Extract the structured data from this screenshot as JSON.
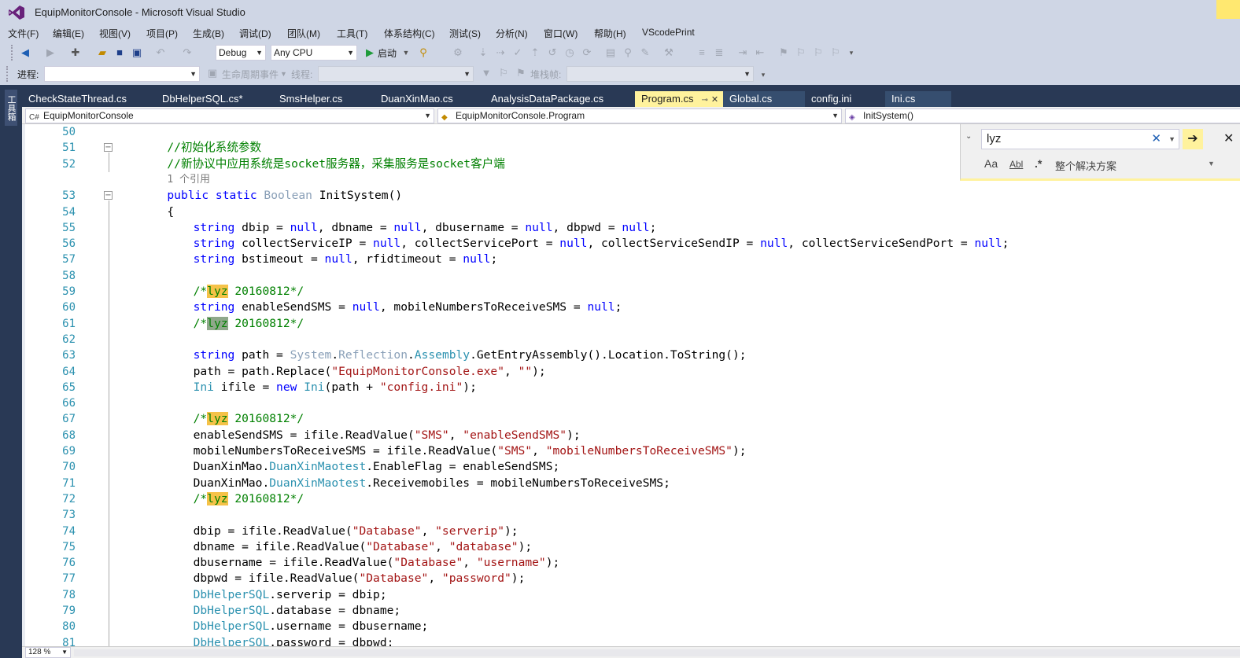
{
  "window": {
    "title": "EquipMonitorConsole - Microsoft Visual Studio"
  },
  "menu": [
    "文件(F)",
    "编辑(E)",
    "视图(V)",
    "项目(P)",
    "生成(B)",
    "调试(D)",
    "团队(M)",
    "工具(T)",
    "体系结构(C)",
    "测试(S)",
    "分析(N)",
    "窗口(W)",
    "帮助(H)",
    "VScodePrint"
  ],
  "toolbar": {
    "config": "Debug",
    "platform": "Any CPU",
    "start_label": "启动",
    "process_label": "进程:",
    "lifecycle_label": "生命周期事件",
    "thread_label": "线程:",
    "stackframe_label": "堆栈帧:"
  },
  "sidebar": {
    "toolbox_label": "工具箱"
  },
  "tabs": [
    {
      "label": "CheckStateThread.cs",
      "state": "normal"
    },
    {
      "label": "DbHelperSQL.cs*",
      "state": "normal"
    },
    {
      "label": "SmsHelper.cs",
      "state": "normal"
    },
    {
      "label": "DuanXinMao.cs",
      "state": "normal"
    },
    {
      "label": "AnalysisDataPackage.cs",
      "state": "normal"
    },
    {
      "label": "Program.cs",
      "state": "active"
    },
    {
      "label": "Global.cs",
      "state": "dark"
    },
    {
      "label": "config.ini",
      "state": "normal"
    },
    {
      "label": "Ini.cs",
      "state": "dark"
    }
  ],
  "nav": {
    "project": "EquipMonitorConsole",
    "class": "EquipMonitorConsole.Program",
    "member": "InitSystem()"
  },
  "find": {
    "query": "lyz",
    "scope": "整个解决方案",
    "opt_case": "Aa",
    "opt_word": "Abl",
    "opt_regex": ".*"
  },
  "status": {
    "zoom": "128 %"
  },
  "code": {
    "ref_count": "1 个引用",
    "lines": [
      {
        "n": "50",
        "html": ""
      },
      {
        "n": "51",
        "html": "<span class=\"cm\">//初始化系统参数</span>",
        "indent": 8,
        "fold": "−"
      },
      {
        "n": "52",
        "html": "<span class=\"cm\">//新协议中应用系统是socket服务器，采集服务是socket客户端</span>",
        "indent": 8
      },
      {
        "n": "53",
        "html": "<span class=\"kw\">public</span> <span class=\"kw\">static</span> <span class=\"typdim\">Boolean</span> InitSystem()",
        "indent": 8,
        "fold": "−"
      },
      {
        "n": "54",
        "html": "{",
        "indent": 8
      },
      {
        "n": "55",
        "html": "<span class=\"kw\">string</span> dbip = <span class=\"kw\">null</span>, dbname = <span class=\"kw\">null</span>, dbusername = <span class=\"kw\">null</span>, dbpwd = <span class=\"kw\">null</span>;",
        "indent": 12
      },
      {
        "n": "56",
        "html": "<span class=\"kw\">string</span> collectServiceIP = <span class=\"kw\">null</span>, collectServicePort = <span class=\"kw\">null</span>, collectServiceSendIP = <span class=\"kw\">null</span>, collectServiceSendPort = <span class=\"kw\">null</span>;",
        "indent": 12
      },
      {
        "n": "57",
        "html": "<span class=\"kw\">string</span> bstimeout = <span class=\"kw\">null</span>, rfidtimeout = <span class=\"kw\">null</span>;",
        "indent": 12
      },
      {
        "n": "58",
        "html": ""
      },
      {
        "n": "59",
        "html": "<span class=\"cm\">/*<span class=\"hl\">lyz</span> 20160812*/</span>",
        "indent": 12
      },
      {
        "n": "60",
        "html": "<span class=\"kw\">string</span> enableSendSMS = <span class=\"kw\">null</span>, mobileNumbersToReceiveSMS = <span class=\"kw\">null</span>;",
        "indent": 12
      },
      {
        "n": "61",
        "html": "<span class=\"cm\">/*<span class=\"hl2\">lyz</span> 20160812*/</span>",
        "indent": 12
      },
      {
        "n": "62",
        "html": ""
      },
      {
        "n": "63",
        "html": "<span class=\"kw\">string</span> path = <span class=\"typdim\">System</span>.<span class=\"typdim\">Reflection</span>.<span class=\"typ\">Assembly</span>.GetEntryAssembly().Location.ToString();",
        "indent": 12
      },
      {
        "n": "64",
        "html": "path = path.Replace(<span class=\"str\">\"EquipMonitorConsole.exe\"</span>, <span class=\"str\">\"\"</span>);",
        "indent": 12
      },
      {
        "n": "65",
        "html": "<span class=\"typ\">Ini</span> ifile = <span class=\"kw\">new</span> <span class=\"typ\">Ini</span>(path + <span class=\"str\">\"config.ini\"</span>);",
        "indent": 12
      },
      {
        "n": "66",
        "html": ""
      },
      {
        "n": "67",
        "html": "<span class=\"cm\">/*<span class=\"hl\">lyz</span> 20160812*/</span>",
        "indent": 12
      },
      {
        "n": "68",
        "html": "enableSendSMS = ifile.ReadValue(<span class=\"str\">\"SMS\"</span>, <span class=\"str\">\"enableSendSMS\"</span>);",
        "indent": 12
      },
      {
        "n": "69",
        "html": "mobileNumbersToReceiveSMS = ifile.ReadValue(<span class=\"str\">\"SMS\"</span>, <span class=\"str\">\"mobileNumbersToReceiveSMS\"</span>);",
        "indent": 12
      },
      {
        "n": "70",
        "html": "DuanXinMao.<span class=\"typ\">DuanXinMaotest</span>.EnableFlag = enableSendSMS;",
        "indent": 12
      },
      {
        "n": "71",
        "html": "DuanXinMao.<span class=\"typ\">DuanXinMaotest</span>.Receivemobiles = mobileNumbersToReceiveSMS;",
        "indent": 12
      },
      {
        "n": "72",
        "html": "<span class=\"cm\">/*<span class=\"hl\">lyz</span> 20160812*/</span>",
        "indent": 12
      },
      {
        "n": "73",
        "html": ""
      },
      {
        "n": "74",
        "html": "dbip = ifile.ReadValue(<span class=\"str\">\"Database\"</span>, <span class=\"str\">\"serverip\"</span>);",
        "indent": 12
      },
      {
        "n": "75",
        "html": "dbname = ifile.ReadValue(<span class=\"str\">\"Database\"</span>, <span class=\"str\">\"database\"</span>);",
        "indent": 12
      },
      {
        "n": "76",
        "html": "dbusername = ifile.ReadValue(<span class=\"str\">\"Database\"</span>, <span class=\"str\">\"username\"</span>);",
        "indent": 12
      },
      {
        "n": "77",
        "html": "dbpwd = ifile.ReadValue(<span class=\"str\">\"Database\"</span>, <span class=\"str\">\"password\"</span>);",
        "indent": 12
      },
      {
        "n": "78",
        "html": "<span class=\"typ\">DbHelperSQL</span>.serverip = dbip;",
        "indent": 12
      },
      {
        "n": "79",
        "html": "<span class=\"typ\">DbHelperSQL</span>.database = dbname;",
        "indent": 12
      },
      {
        "n": "80",
        "html": "<span class=\"typ\">DbHelperSQL</span>.username = dbusername;",
        "indent": 12
      },
      {
        "n": "81",
        "html": "<span class=\"typ\">DbHelperSQL</span>.password = dbpwd;",
        "indent": 12
      }
    ]
  }
}
